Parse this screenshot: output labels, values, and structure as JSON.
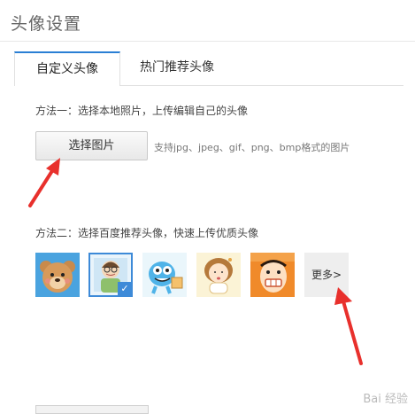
{
  "page": {
    "title": "头像设置"
  },
  "tabs": [
    {
      "label": "自定义头像",
      "active": true
    },
    {
      "label": "热门推荐头像",
      "active": false
    }
  ],
  "method1": {
    "text": "方法一：选择本地照片，上传编辑自己的头像",
    "button_label": "选择图片",
    "hint": "支持jpg、jpeg、gif、png、bmp格式的图片"
  },
  "method2": {
    "text": "方法二：选择百度推荐头像，快速上传优质头像",
    "avatars": [
      {
        "icon": "bear-avatar-icon",
        "selected": false
      },
      {
        "icon": "boy-avatar-icon",
        "selected": true
      },
      {
        "icon": "monster-avatar-icon",
        "selected": false
      },
      {
        "icon": "girl-avatar-icon",
        "selected": false
      },
      {
        "icon": "funny-face-avatar-icon",
        "selected": false
      }
    ],
    "more_label": "更多>"
  },
  "colors": {
    "accent": "#2a7fd4",
    "arrow": "#e8302c"
  },
  "watermark": "Bai 经验"
}
